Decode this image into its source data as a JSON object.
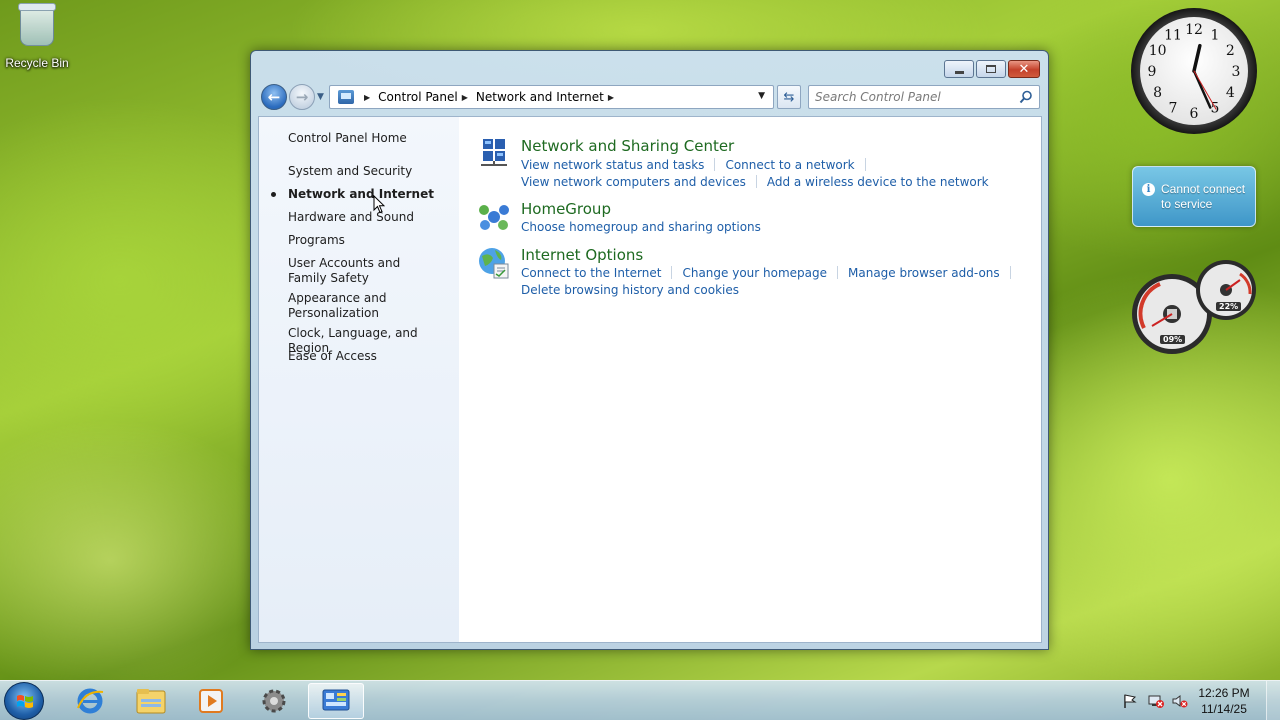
{
  "desktop": {
    "icons": [
      {
        "label": "Recycle Bin",
        "icon": "recycle-bin-icon"
      }
    ]
  },
  "window": {
    "caption": {
      "minimize": "minimize",
      "maximize": "maximize",
      "close": "close"
    },
    "breadcrumb": [
      "Control Panel",
      "Network and Internet"
    ],
    "search_placeholder": "Search Control Panel",
    "left_nav": {
      "home": "Control Panel Home",
      "items": [
        {
          "label": "System and Security",
          "current": false
        },
        {
          "label": "Network and Internet",
          "current": true
        },
        {
          "label": "Hardware and Sound",
          "current": false
        },
        {
          "label": "Programs",
          "current": false
        },
        {
          "label": "User Accounts and Family Safety",
          "current": false
        },
        {
          "label": "Appearance and Personalization",
          "current": false
        },
        {
          "label": "Clock, Language, and Region",
          "current": false
        },
        {
          "label": "Ease of Access",
          "current": false
        }
      ]
    },
    "categories": [
      {
        "title": "Network and Sharing Center",
        "icon": "network-sharing-icon",
        "links": [
          [
            "View network status and tasks",
            "Connect to a network"
          ],
          [
            "View network computers and devices",
            "Add a wireless device to the network"
          ]
        ]
      },
      {
        "title": "HomeGroup",
        "icon": "homegroup-icon",
        "links": [
          [
            "Choose homegroup and sharing options"
          ]
        ]
      },
      {
        "title": "Internet Options",
        "icon": "internet-options-icon",
        "links": [
          [
            "Connect to the Internet",
            "Change your homepage",
            "Manage browser add-ons"
          ],
          [
            "Delete browsing history and cookies"
          ]
        ]
      }
    ]
  },
  "gadgets": {
    "clock_numbers": [
      "12",
      "1",
      "2",
      "3",
      "4",
      "5",
      "6",
      "7",
      "8",
      "9",
      "10",
      "11"
    ],
    "weather_notice": "Cannot connect to service",
    "cpu_meter": {
      "cpu": "09%",
      "memory": "22%"
    }
  },
  "taskbar": {
    "pinned": [
      "internet-explorer-icon",
      "windows-explorer-icon",
      "media-player-icon",
      "settings-gear-icon",
      "control-panel-icon"
    ],
    "active_index": 4,
    "time": "12:26 PM",
    "date": "11/14/25"
  },
  "colors": {
    "category_title": "#1e6a21",
    "link": "#1e5ea8",
    "notice_bg": "#3c96d2"
  }
}
